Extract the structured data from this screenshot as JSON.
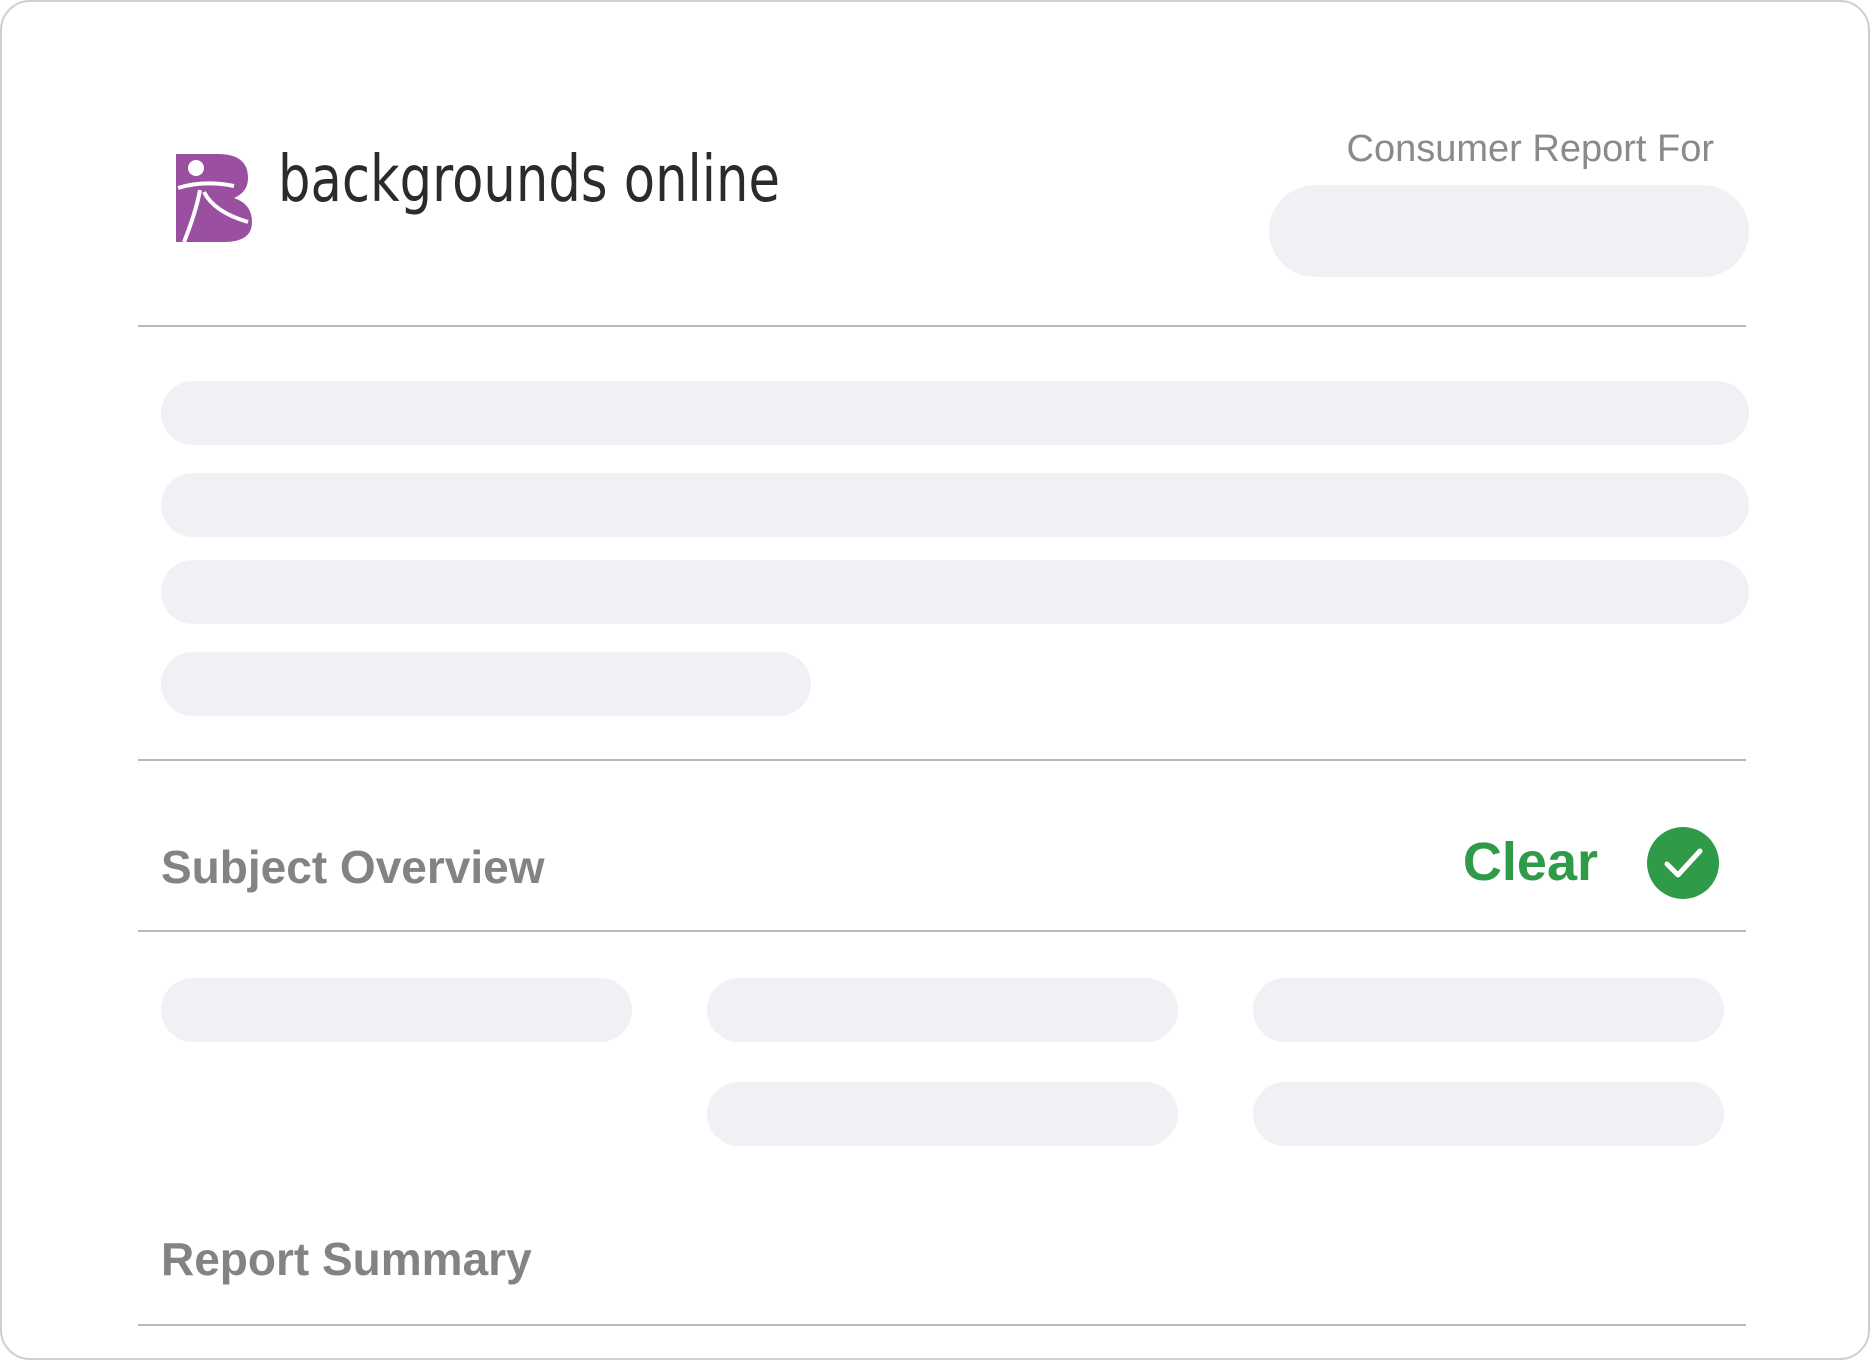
{
  "header": {
    "brand_name": "backgrounds online",
    "report_for_label": "Consumer Report For",
    "brand_color": "#9b4fa0"
  },
  "sections": {
    "subject_overview": {
      "title": "Subject Overview",
      "status_label": "Clear",
      "status_color": "#2f9a47",
      "status_icon": "check-circle-icon"
    },
    "report_summary": {
      "title": "Report Summary"
    }
  }
}
